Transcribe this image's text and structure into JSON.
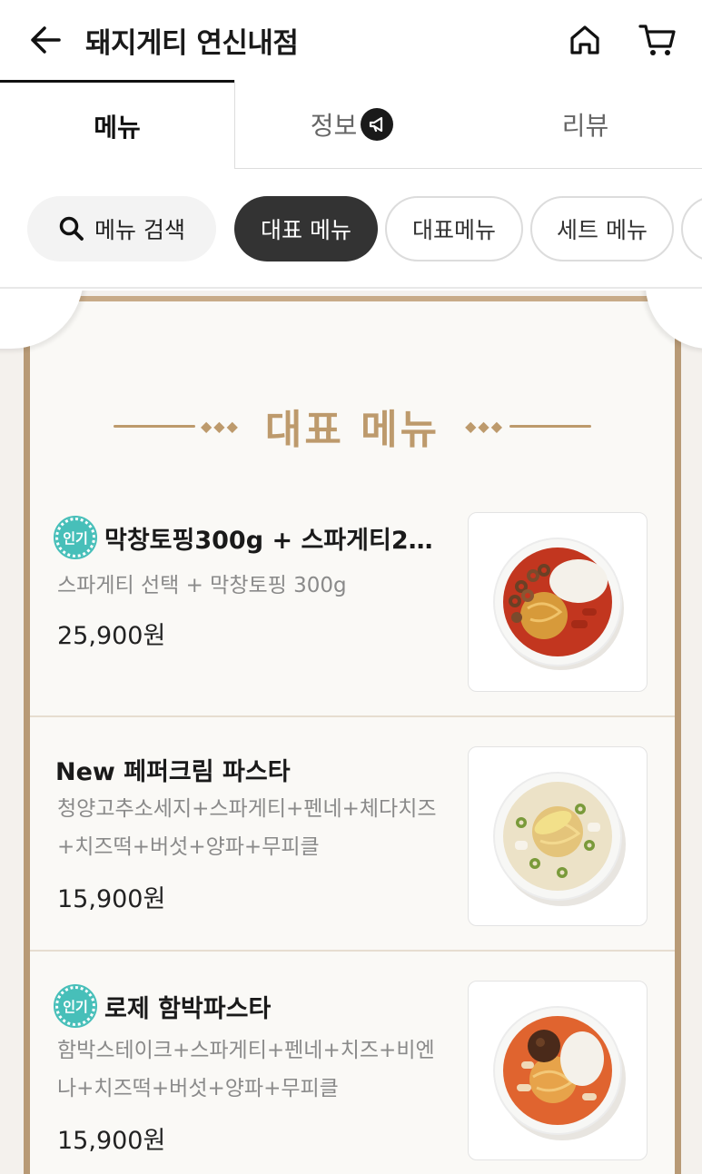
{
  "header": {
    "title": "돼지게티 연신내점",
    "back_icon": "arrow-left-icon",
    "home_icon": "home-icon",
    "cart_icon": "cart-icon"
  },
  "tabs": [
    {
      "label": "메뉴",
      "active": true
    },
    {
      "label": "정보",
      "active": false,
      "badge_icon": "megaphone-icon"
    },
    {
      "label": "리뷰",
      "active": false
    }
  ],
  "chips": {
    "search_label": "메뉴 검색",
    "items": [
      {
        "label": "대표 메뉴",
        "active": true
      },
      {
        "label": "대표메뉴",
        "active": false
      },
      {
        "label": "세트 메뉴",
        "active": false
      }
    ]
  },
  "section": {
    "title": "대표 메뉴",
    "accent_color": "#bd9a6c"
  },
  "menu_items": [
    {
      "badge": "인기",
      "name": "막창토핑300g + 스파게티2…",
      "description": "스파게티 선택 + 막창토핑 300g",
      "price": "25,900원"
    },
    {
      "badge": "",
      "name": "New 페퍼크림 파스타",
      "description": "청양고추소세지+스파게티+펜네+체다치즈+치즈떡+버섯+양파+무피클",
      "price": "15,900원"
    },
    {
      "badge": "인기",
      "name": "로제 함박파스타",
      "description": "함박스테이크+스파게티+펜네+치즈+비엔나+치즈떡+버섯+양파+무피클",
      "price": "15,900원"
    }
  ]
}
